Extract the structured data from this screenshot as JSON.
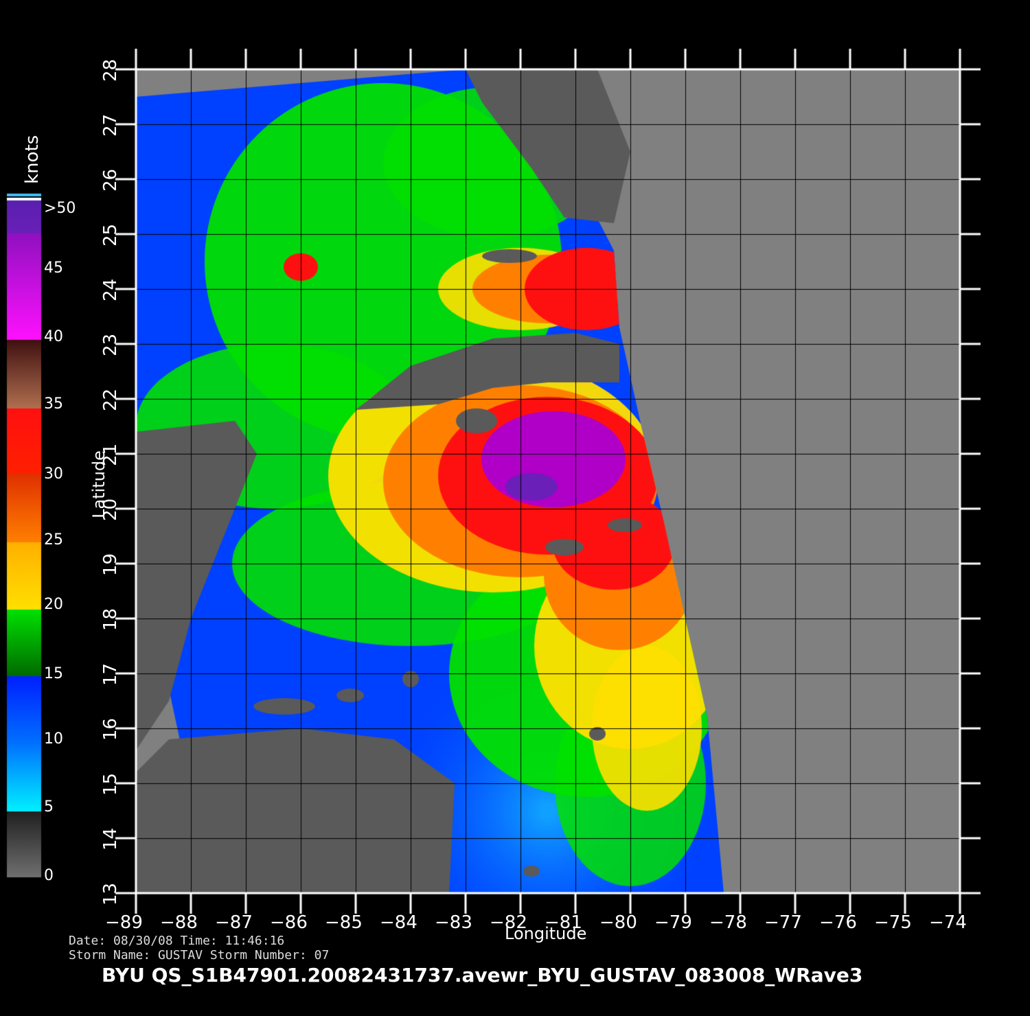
{
  "map": {
    "lon_range": [
      -89,
      -74
    ],
    "lat_range": [
      13,
      28
    ],
    "lon_ticks": [
      -89,
      -88,
      -87,
      -86,
      -85,
      -84,
      -83,
      -82,
      -81,
      -80,
      -79,
      -78,
      -77,
      -76,
      -75,
      -74
    ],
    "lat_ticks": [
      13,
      14,
      15,
      16,
      17,
      18,
      19,
      20,
      21,
      22,
      23,
      24,
      25,
      26,
      27,
      28
    ],
    "lon_tick_labels": [
      "−89",
      "−88",
      "−87",
      "−86",
      "−85",
      "−84",
      "−83",
      "−82",
      "−81",
      "−80",
      "−79",
      "−78",
      "−77",
      "−76",
      "−75",
      "−74"
    ],
    "lat_tick_labels": [
      "13",
      "14",
      "15",
      "16",
      "17",
      "18",
      "19",
      "20",
      "21",
      "22",
      "23",
      "24",
      "25",
      "26",
      "27",
      "28"
    ],
    "xlabel": "Longitude",
    "ylabel": "Latitude",
    "grid": true,
    "storm_center": {
      "lon": -81.8,
      "lat": 20.4
    },
    "no_data_color": "#808080",
    "land_color": "#5a5a5a"
  },
  "colorbar": {
    "unit": "knots",
    "labels": [
      ">50",
      "45",
      "40",
      "35",
      "30",
      "25",
      "20",
      "15",
      "10",
      "5",
      "0"
    ],
    "colors": {
      "v50": "#6a1fb8",
      "v45": "#b000c8",
      "v40": "#ff10ff",
      "v35": "#b07050",
      "v30": "#ff1010",
      "v25": "#ff8000",
      "v20": "#ffe000",
      "v15": "#00e000",
      "v10": "#0040ff",
      "v5": "#00f0ff",
      "v0": "#707070"
    }
  },
  "meta": {
    "line1": "Date: 08/30/08   Time: 11:46:16",
    "line2": "Storm  Name: GUSTAV   Storm  Number: 07"
  },
  "footer": "BYU  QS_S1B47901.20082431737.avewr_BYU_GUSTAV_083008_WRave3"
}
